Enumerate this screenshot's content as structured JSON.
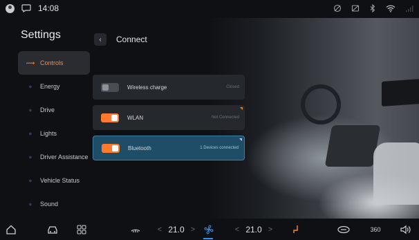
{
  "status": {
    "time": "14:08"
  },
  "sidebar": {
    "title": "Settings",
    "items": [
      {
        "label": "Controls",
        "active": true
      },
      {
        "label": "Energy"
      },
      {
        "label": "Drive"
      },
      {
        "label": "Lights"
      },
      {
        "label": "Driver Assistance"
      },
      {
        "label": "Vehicle Status"
      },
      {
        "label": "Sound"
      }
    ]
  },
  "header": {
    "back": "‹",
    "title": "Connect"
  },
  "toggles": [
    {
      "label": "Wireless charge",
      "status": "Closed",
      "on": false
    },
    {
      "label": "WLAN",
      "status": "Not Connected",
      "on": true
    },
    {
      "label": "Bluetooth",
      "status": "1 Devices connected",
      "on": true
    }
  ],
  "bottom": {
    "temp_left": "21.0",
    "temp_right": "21.0",
    "left_arrow": "<",
    "right_arrow": ">",
    "view_360": "360"
  },
  "colors": {
    "accent": "#ff7a2e",
    "selected_card": "#1f4c66",
    "fan": "#3f8fe0"
  }
}
